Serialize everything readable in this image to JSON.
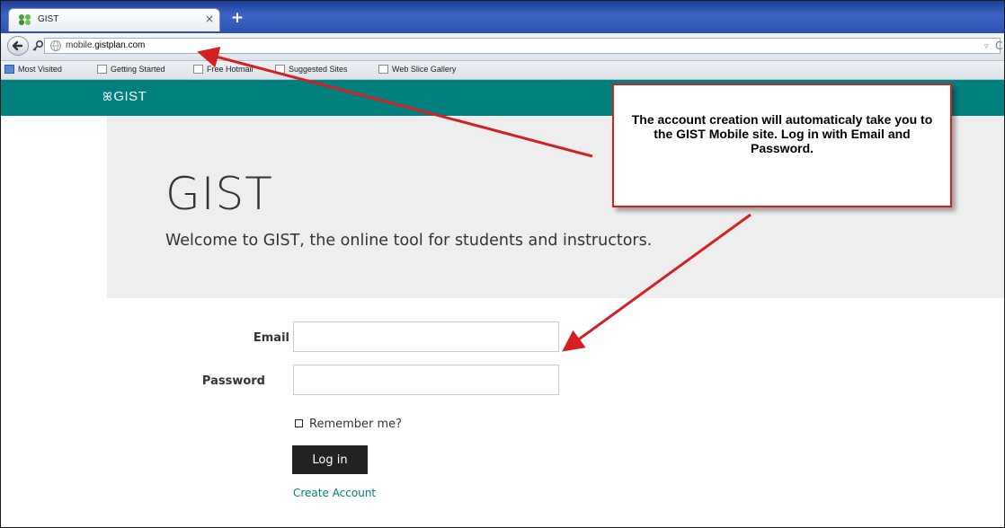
{
  "browser": {
    "tab_title": "GIST",
    "new_tab_label": "+",
    "url_prefix": "mobile.",
    "url_domain": "gistplan.com",
    "reload_glyph": "C",
    "bookmarks": [
      "Most Visited",
      "Getting Started",
      "Free Hotmail",
      "Suggested Sites",
      "Web Slice Gallery"
    ]
  },
  "site": {
    "logo_text": "GIST",
    "logo_mark": "ꕤ",
    "hero_title": "GIST",
    "hero_subtitle": "Welcome to GIST, the online tool for students and instructors."
  },
  "form": {
    "email_label": "Email",
    "email_value": "",
    "password_label": "Password",
    "password_value": "",
    "remember_label": "Remember me?",
    "remember_checked": false,
    "login_label": "Log in",
    "create_account_label": "Create Account"
  },
  "callout": {
    "text": "The account creation will automaticaly take you to the GIST Mobile site.  Log in with Email and Password."
  },
  "colors": {
    "header": "#00807f",
    "hero_bg": "#eeeeee",
    "link": "#00807f",
    "button": "#222222",
    "arrow": "#d42020"
  },
  "icons": [
    "gist-favicon-icon",
    "close-icon",
    "back-arrow-icon",
    "key-icon",
    "globe-icon",
    "dropdown-icon",
    "reload-icon",
    "bookmark-icon",
    "checkbox-icon",
    "arrow-icon"
  ]
}
